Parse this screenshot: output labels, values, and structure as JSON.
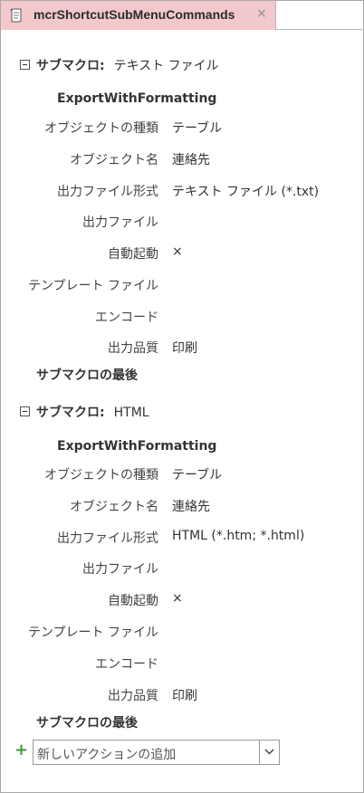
{
  "tab": {
    "title": "mcrShortcutSubMenuCommands",
    "close": "×"
  },
  "submacros": [
    {
      "label": "サブマクロ:",
      "name": "テキスト ファイル",
      "action": "ExportWithFormatting",
      "args": [
        {
          "label": "オブジェクトの種類",
          "value": "テーブル"
        },
        {
          "label": "オブジェクト名",
          "value": "連絡先"
        },
        {
          "label": "出力ファイル形式",
          "value": "テキスト ファイル (*.txt)"
        },
        {
          "label": "出力ファイル",
          "value": ""
        },
        {
          "label": "自動起動",
          "value": "×"
        },
        {
          "label": "テンプレート ファイル",
          "value": ""
        },
        {
          "label": "エンコード",
          "value": ""
        },
        {
          "label": "出力品質",
          "value": "印刷"
        }
      ],
      "end": "サブマクロの最後"
    },
    {
      "label": "サブマクロ:",
      "name": "HTML",
      "action": "ExportWithFormatting",
      "args": [
        {
          "label": "オブジェクトの種類",
          "value": "テーブル"
        },
        {
          "label": "オブジェクト名",
          "value": "連絡先"
        },
        {
          "label": "出力ファイル形式",
          "value": "HTML (*.htm; *.html)"
        },
        {
          "label": "出力ファイル",
          "value": ""
        },
        {
          "label": "自動起動",
          "value": "×"
        },
        {
          "label": "テンプレート ファイル",
          "value": ""
        },
        {
          "label": "エンコード",
          "value": ""
        },
        {
          "label": "出力品質",
          "value": "印刷"
        }
      ],
      "end": "サブマクロの最後"
    }
  ],
  "add_action": {
    "plus": "+",
    "placeholder": "新しいアクションの追加"
  }
}
